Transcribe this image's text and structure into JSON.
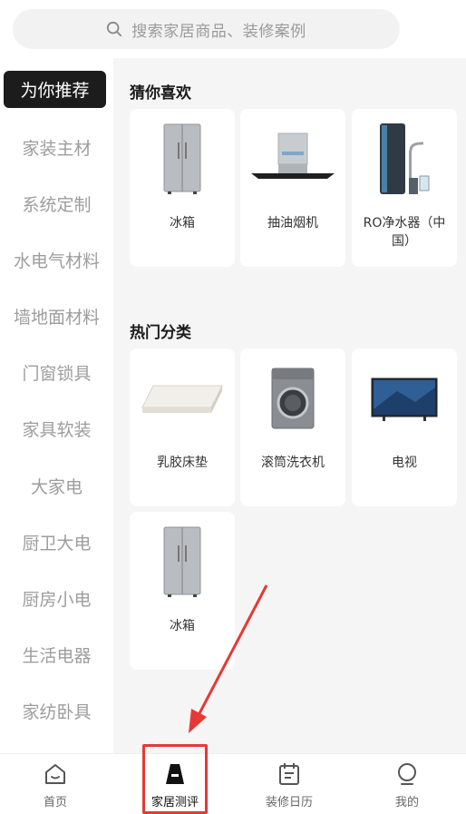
{
  "search": {
    "placeholder": "搜索家居商品、装修案例"
  },
  "sidebar": {
    "items": [
      {
        "label": "为你推荐"
      },
      {
        "label": "家装主材"
      },
      {
        "label": "系统定制"
      },
      {
        "label": "水电气材料"
      },
      {
        "label": "墙地面材料"
      },
      {
        "label": "门窗锁具"
      },
      {
        "label": "家具软装"
      },
      {
        "label": "大家电"
      },
      {
        "label": "厨卫大电"
      },
      {
        "label": "厨房小电"
      },
      {
        "label": "生活电器"
      },
      {
        "label": "家纺卧具"
      }
    ]
  },
  "guess": {
    "title": "猜你喜欢",
    "items": [
      {
        "name": "冰箱",
        "icon": "fridge-icon"
      },
      {
        "name": "抽油烟机",
        "icon": "range-hood-icon"
      },
      {
        "name": "RO净水器（中国）",
        "icon": "water-purifier-icon"
      }
    ]
  },
  "hot": {
    "title": "热门分类",
    "items": [
      {
        "name": "乳胶床垫",
        "icon": "mattress-icon"
      },
      {
        "name": "滚筒洗衣机",
        "icon": "washing-machine-icon"
      },
      {
        "name": "电视",
        "icon": "tv-icon"
      },
      {
        "name": "冰箱",
        "icon": "fridge-icon"
      }
    ]
  },
  "tabbar": {
    "tabs": [
      {
        "label": "首页",
        "icon": "home-icon"
      },
      {
        "label": "家居测评",
        "icon": "evaluation-icon"
      },
      {
        "label": "装修日历",
        "icon": "calendar-icon"
      },
      {
        "label": "我的",
        "icon": "profile-icon"
      }
    ]
  },
  "colors": {
    "active_bg": "#1c1c1c",
    "highlight": "#e53935",
    "content_bg": "#f5f5f5"
  }
}
